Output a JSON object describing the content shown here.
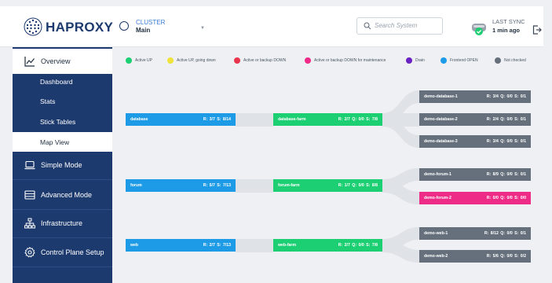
{
  "header": {
    "logo_text": "HAPROXY",
    "cluster_label": "CLUSTER",
    "cluster_value": "Main",
    "search_placeholder": "Search System",
    "sync_label": "LAST SYNC",
    "sync_value": "1 min ago"
  },
  "sidebar": {
    "items": [
      {
        "label": "Overview",
        "icon": "chart-line-icon",
        "active": true
      },
      {
        "label": "Dashboard"
      },
      {
        "label": "Stats"
      },
      {
        "label": "Stick Tables"
      },
      {
        "label": "Map View",
        "active": true
      },
      {
        "label": "Simple Mode",
        "icon": "laptop-icon"
      },
      {
        "label": "Advanced Mode",
        "icon": "server-rack-icon"
      },
      {
        "label": "Infrastructure",
        "icon": "network-tree-icon"
      },
      {
        "label": "Control Plane Setup",
        "icon": "gear-icon"
      }
    ]
  },
  "legend": [
    {
      "label": "Active UP",
      "color": "#1ccf72"
    },
    {
      "label": "Active UP, going down",
      "color": "#f0e23a"
    },
    {
      "label": "Active or backup DOWN",
      "color": "#e8344c"
    },
    {
      "label": "Active or backup DOWN for maintenance",
      "color": "#ee2b87"
    },
    {
      "label": "Drain",
      "color": "#6a22c4"
    },
    {
      "label": "Frontend OPEN",
      "color": "#1e9be6"
    },
    {
      "label": "Not checked",
      "color": "#65707c"
    }
  ],
  "map": {
    "groups": [
      {
        "frontend": {
          "name": "database",
          "stats": "R: 3/7   S: 8/14"
        },
        "backend": {
          "name": "database-farm",
          "stats": "R: 2/7   Q: 0/0   S: 7/8"
        },
        "servers": [
          {
            "name": "demo-database-1",
            "stats": "R: 3/4  Q: 0/0  S: 0/1",
            "status": "gray"
          },
          {
            "name": "demo-database-2",
            "stats": "R: 2/4  Q: 0/0  S: 0/1",
            "status": "gray"
          },
          {
            "name": "demo-database-3",
            "stats": "R: 3/4  Q: 0/0  S: 0/1",
            "status": "gray"
          }
        ]
      },
      {
        "frontend": {
          "name": "forum",
          "stats": "R: 5/7   S: 7/13"
        },
        "backend": {
          "name": "forum-farm",
          "stats": "R: 1/7   Q: 0/0   S: 8/8"
        },
        "servers": [
          {
            "name": "demo-forum-1",
            "stats": "R: 8/9  Q: 0/0  S: 0/1",
            "status": "gray"
          },
          {
            "name": "demo-forum-2",
            "stats": "R: 0/0  Q: 0/0  S: 0/0",
            "status": "pink"
          }
        ]
      },
      {
        "frontend": {
          "name": "web",
          "stats": "R: 2/7   S: 7/13"
        },
        "backend": {
          "name": "web-farm",
          "stats": "R: 2/7   Q: 0/0   S: 7/8"
        },
        "servers": [
          {
            "name": "demo-web-1",
            "stats": "R: 8/12  Q: 0/0  S: 0/1",
            "status": "gray"
          },
          {
            "name": "demo-web-2",
            "stats": "R: 5/6  Q: 0/0  S: 0/2",
            "status": "gray"
          }
        ]
      }
    ]
  }
}
